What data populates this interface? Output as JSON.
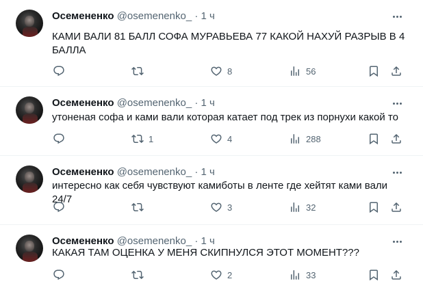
{
  "tweets": [
    {
      "name": "Осемененко",
      "handle": "@osemenenko_",
      "dot": "·",
      "time": "1 ч",
      "text": "КАМИ ВАЛИ 81 БАЛЛ СОФА МУРАВЬЕВА 77 КАКОЙ НАХУЙ РАЗРЫВ В 4 БАЛЛА",
      "replies": "",
      "retweets": "",
      "likes": "8",
      "views": "56"
    },
    {
      "name": "Осемененко",
      "handle": "@osemenenko_",
      "dot": "·",
      "time": "1 ч",
      "text": "утоненая софа и ками вали которая катает под трек из порнухи какой то",
      "replies": "",
      "retweets": "1",
      "likes": "4",
      "views": "288"
    },
    {
      "name": "Осемененко",
      "handle": "@osemenenko_",
      "dot": "·",
      "time": "1 ч",
      "text": "интересно как себя чувствуют камиботы в ленте где хейтят ками вали 24/7",
      "replies": "",
      "retweets": "",
      "likes": "3",
      "views": "32"
    },
    {
      "name": "Осемененко",
      "handle": "@osemenenko_",
      "dot": "·",
      "time": "1 ч",
      "text": "КАКАЯ ТАМ ОЦЕНКА У МЕНЯ СКИПНУЛСЯ ЭТОТ МОМЕНТ???",
      "replies": "",
      "retweets": "",
      "likes": "2",
      "views": "33"
    }
  ],
  "icons": {
    "reply": "reply-icon",
    "retweet": "retweet-icon",
    "like": "heart-icon",
    "views": "views-icon",
    "bookmark": "bookmark-icon",
    "share": "share-icon",
    "more": "more-icon"
  },
  "colors": {
    "text": "#0f1419",
    "secondary": "#536471",
    "divider": "#eff3f4"
  }
}
